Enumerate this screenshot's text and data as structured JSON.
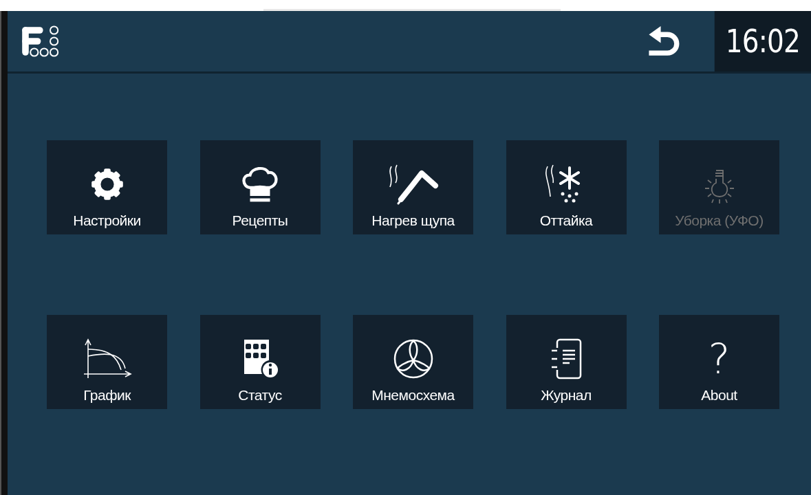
{
  "header": {
    "time": "16:02"
  },
  "tiles": [
    {
      "label": "Настройки",
      "disabled": false
    },
    {
      "label": "Рецепты",
      "disabled": false
    },
    {
      "label": "Нагрев щупа",
      "disabled": false
    },
    {
      "label": "Оттайка",
      "disabled": false
    },
    {
      "label": "Уборка (УФО)",
      "disabled": true
    },
    {
      "label": "График",
      "disabled": false
    },
    {
      "label": "Статус",
      "disabled": false
    },
    {
      "label": "Мнемосхема",
      "disabled": false
    },
    {
      "label": "Журнал",
      "disabled": false
    },
    {
      "label": "About",
      "glyph": "?",
      "disabled": false
    }
  ]
}
